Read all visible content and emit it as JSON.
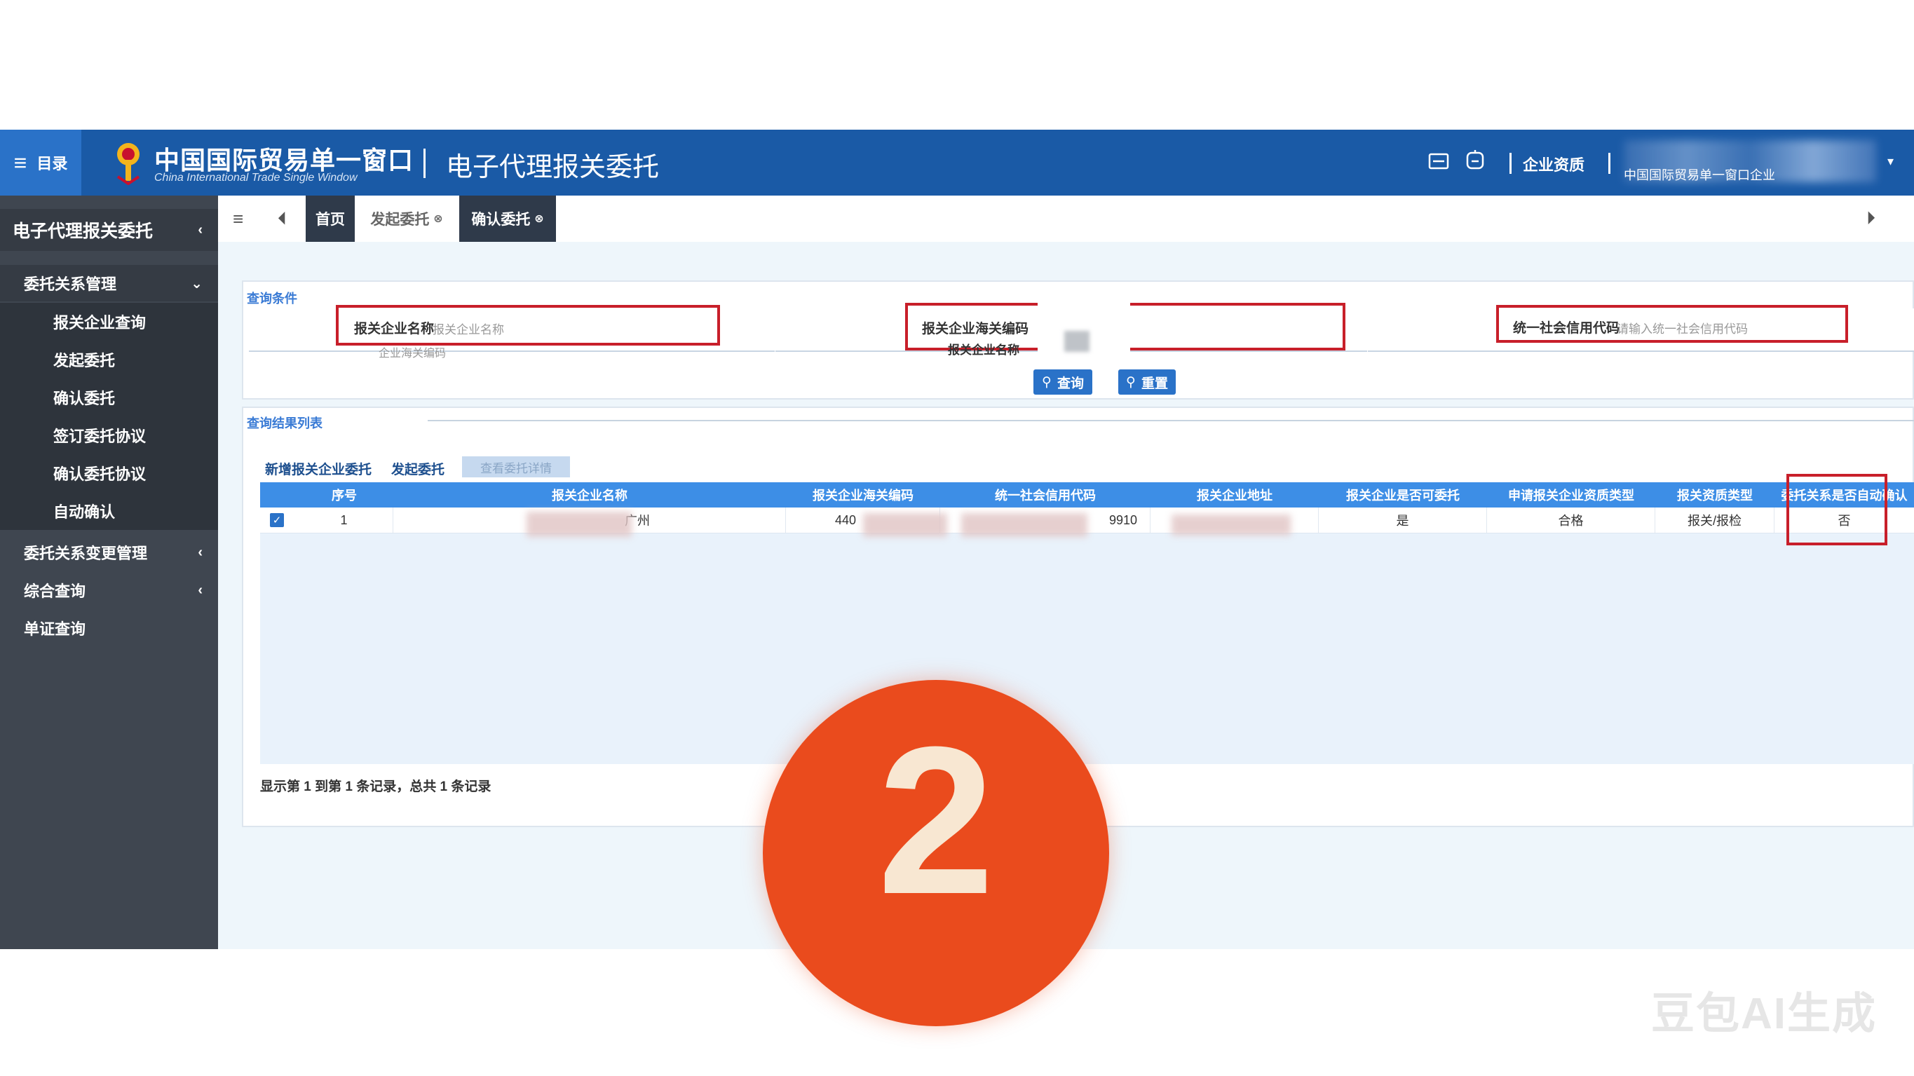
{
  "header": {
    "menu_label": "目录",
    "brand_cn": "中国国际贸易单一窗口",
    "brand_en": "China International Trade Single Window",
    "page_title": "电子代理报关委托",
    "enterprise_label": "企业资质",
    "user_name": "中国国际贸易单一窗口企业"
  },
  "tabs": {
    "home": "首页",
    "tab_a": "发起委托",
    "tab_b": "确认委托"
  },
  "sidebar": {
    "section_title": "电子代理报关委托",
    "group_main": "委托关系管理",
    "items": [
      "报关企业查询",
      "发起委托",
      "确认委托",
      "签订委托协议",
      "确认委托协议",
      "自动确认"
    ],
    "group_2": "委托关系变更管理",
    "group_3": "综合查询",
    "group_4": "单证查询"
  },
  "search": {
    "legend": "查询条件",
    "field1_label": "报关企业名称",
    "field1_placeholder": "报关企业名称",
    "field1_sub": "企业海关编码",
    "field2_label": "报关企业海关编码",
    "field2_sub": "报关企业名称",
    "field3_label": "统一社会信用代码",
    "field3_placeholder": "请输入统一社会信用代码",
    "btn_query": "查询",
    "btn_reset": "重置"
  },
  "list": {
    "legend": "查询结果列表",
    "toolbar": [
      "新增报关企业委托",
      "发起委托",
      "查看委托详情"
    ],
    "columns": [
      "序号",
      "报关企业名称",
      "报关企业海关编码",
      "统一社会信用代码",
      "报关企业地址",
      "报关企业是否可委托",
      "申请报关企业资质类型",
      "报关资质类型",
      "委托关系是否自动确认"
    ],
    "row": {
      "index": "1",
      "name": "广州",
      "code": "440",
      "credit": "9910",
      "address": "",
      "can_entrust": "是",
      "qual_type": "合格",
      "cert": "报关/报检",
      "auto_confirm": "否"
    },
    "pager": "显示第 1 到第 1 条记录，总共 1 条记录"
  },
  "badge": {
    "number": "2",
    "color": "#ea4b1d"
  },
  "watermark": "豆包AI生成",
  "colors": {
    "header_blue": "#1a5aa6",
    "sidebar": "#3f4650",
    "highlight_red": "#c81f2a",
    "grid_head": "#3d8ee6"
  }
}
